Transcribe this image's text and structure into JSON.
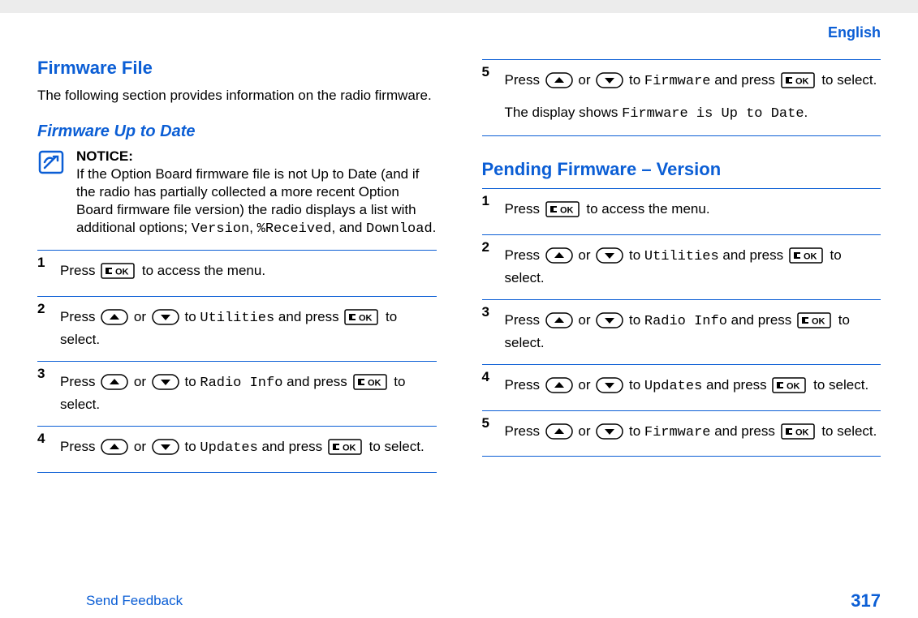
{
  "header": {
    "language": "English"
  },
  "left": {
    "h2": "Firmware File",
    "intro": "The following section provides information on the radio firmware.",
    "h3": "Firmware Up to Date",
    "notice": {
      "title": "NOTICE:",
      "body_pre": "If the Option Board firmware file is not Up to Date (and if the radio has partially collected a more recent Option Board firmware file version) the radio displays a list with additional options; ",
      "opt1": "Version",
      "sep1": ", ",
      "opt2": "%Received",
      "sep2": ", and ",
      "opt3": "Download",
      "end": "."
    },
    "steps": [
      {
        "pre": "Press ",
        "post": " to access the menu.",
        "kind": "ok"
      },
      {
        "pre": "Press ",
        "mid": " or ",
        "tgt_pre": " to ",
        "tgt": "Utilities",
        "tgt_post": " and press ",
        "post": " to select.",
        "kind": "updown_ok"
      },
      {
        "pre": "Press ",
        "mid": " or ",
        "tgt_pre": " to ",
        "tgt": "Radio Info",
        "tgt_post": " and press ",
        "post": " to select.",
        "kind": "updown_ok"
      },
      {
        "pre": "Press ",
        "mid": " or ",
        "tgt_pre": " to ",
        "tgt": "Updates",
        "tgt_post": " and press ",
        "post": " to select.",
        "kind": "updown_ok"
      }
    ]
  },
  "right": {
    "top_step": {
      "pre": "Press ",
      "mid": " or ",
      "tgt_pre": " to ",
      "tgt": "Firmware",
      "tgt_post": " and press ",
      "post": " to select.",
      "extra_pre": "The display shows ",
      "extra_mono": "Firmware is Up to Date",
      "extra_post": "."
    },
    "h2": "Pending Firmware – Version",
    "steps": [
      {
        "pre": "Press ",
        "post": " to access the menu.",
        "kind": "ok"
      },
      {
        "pre": "Press ",
        "mid": " or ",
        "tgt_pre": " to ",
        "tgt": "Utilities",
        "tgt_post": " and press ",
        "post": " to select.",
        "kind": "updown_ok"
      },
      {
        "pre": "Press ",
        "mid": " or ",
        "tgt_pre": " to ",
        "tgt": "Radio Info",
        "tgt_post": " and press ",
        "post": " to select.",
        "kind": "updown_ok"
      },
      {
        "pre": "Press ",
        "mid": " or ",
        "tgt_pre": " to ",
        "tgt": "Updates",
        "tgt_post": " and press ",
        "post": " to select.",
        "kind": "updown_ok"
      },
      {
        "pre": "Press ",
        "mid": " or ",
        "tgt_pre": " to ",
        "tgt": "Firmware",
        "tgt_post": " and press ",
        "post": " to select.",
        "kind": "updown_ok"
      }
    ]
  },
  "footer": {
    "feedback": "Send Feedback",
    "page": "317"
  }
}
